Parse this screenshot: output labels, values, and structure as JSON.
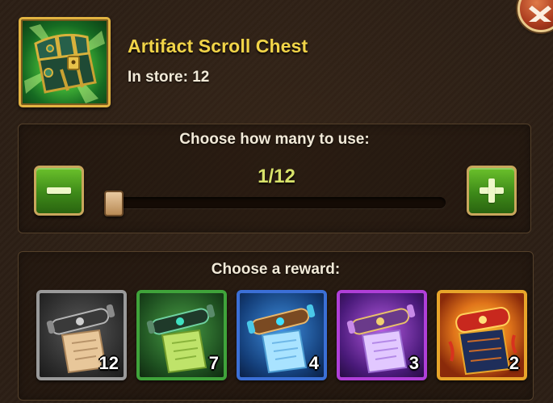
{
  "item": {
    "name": "Artifact Scroll Chest",
    "in_store": "In store: 12"
  },
  "quantity": {
    "label": "Choose how many to use:",
    "value": "1/12",
    "selected_fraction": 0.0833
  },
  "rewards": {
    "label": "Choose a reward:",
    "items": [
      {
        "rarity": "white",
        "count": "12",
        "frame_color": "#9a9a9a"
      },
      {
        "rarity": "green",
        "count": "7",
        "frame_color": "#3fa33a"
      },
      {
        "rarity": "blue",
        "count": "4",
        "frame_color": "#3b6fd6"
      },
      {
        "rarity": "violet",
        "count": "3",
        "frame_color": "#b03fd8"
      },
      {
        "rarity": "orange",
        "count": "2",
        "frame_color": "#e8a52a"
      }
    ]
  },
  "icons": {
    "close": "close-icon",
    "minus": "minus-icon",
    "plus": "plus-icon"
  }
}
